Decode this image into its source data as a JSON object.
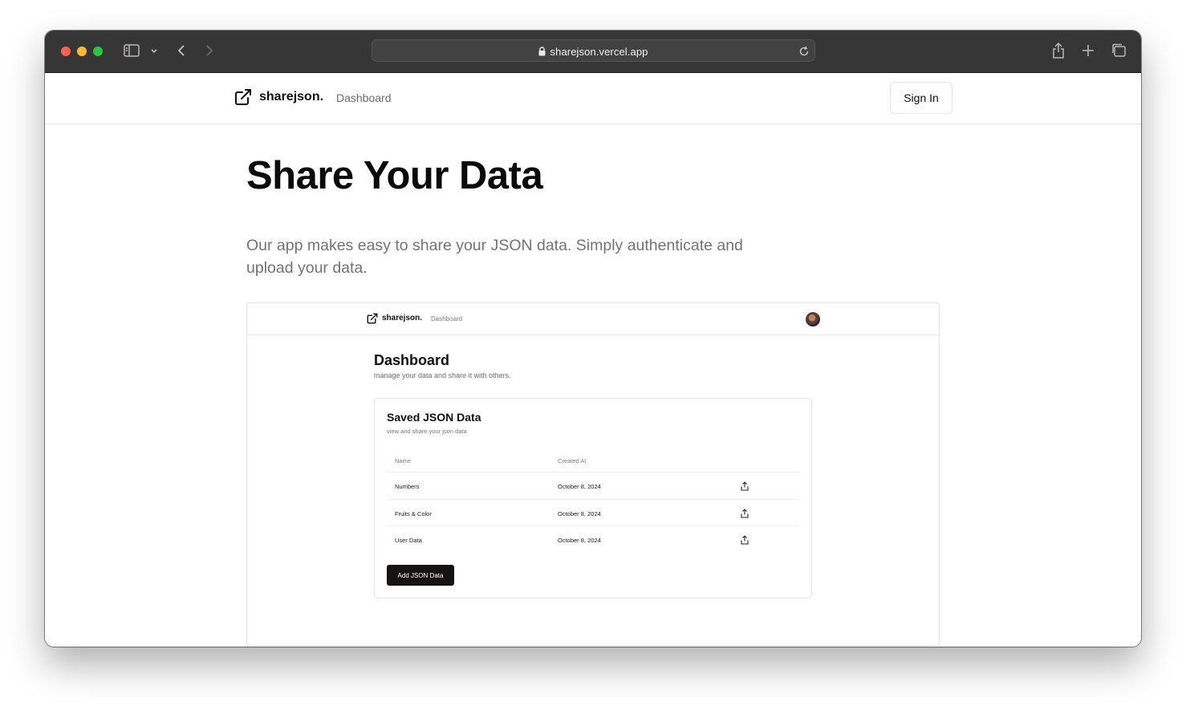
{
  "browser": {
    "url": "sharejson.vercel.app"
  },
  "header": {
    "brand": "sharejson.",
    "nav_dashboard": "Dashboard",
    "sign_in": "Sign In"
  },
  "hero": {
    "title": "Share Your Data",
    "subtitle": "Our app makes easy to share your JSON data. Simply authenticate and upload your data."
  },
  "preview": {
    "brand": "sharejson.",
    "nav_dashboard": "Dashboard",
    "title": "Dashboard",
    "subtitle": "manage your data and share it with others.",
    "card": {
      "title": "Saved JSON Data",
      "subtitle": "view and share your json data",
      "columns": [
        "Name",
        "Created At"
      ],
      "rows": [
        {
          "name": "Numbers",
          "created": "October 8, 2024"
        },
        {
          "name": "Fruits & Color",
          "created": "October 8, 2024"
        },
        {
          "name": "User Data",
          "created": "October 8, 2024"
        }
      ],
      "add_button": "Add JSON Data"
    }
  },
  "icons": {
    "brand": "external-link-icon",
    "row_action": "share-icon"
  }
}
